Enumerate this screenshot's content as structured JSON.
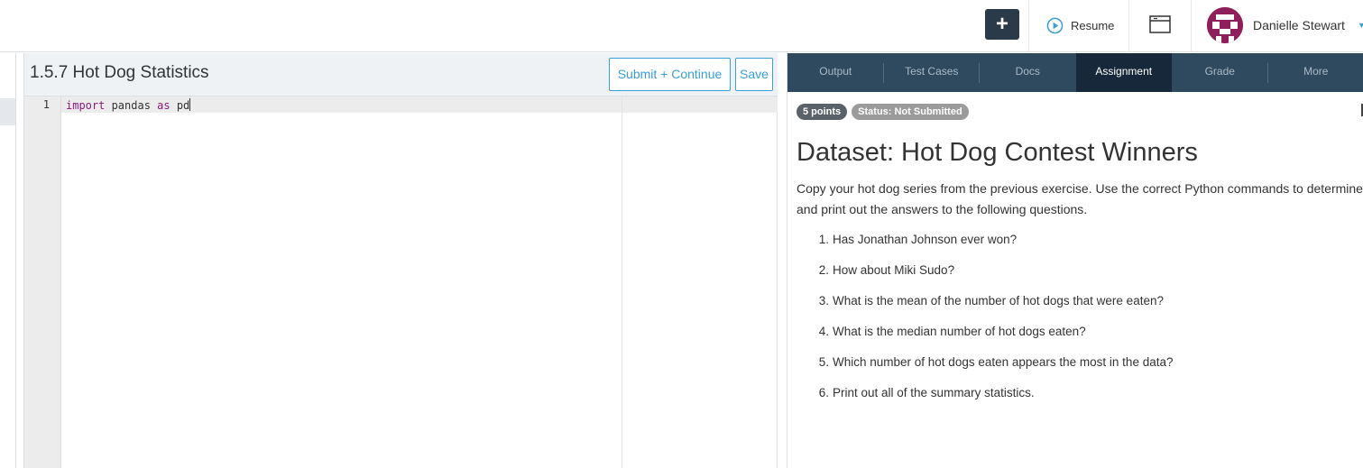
{
  "topbar": {
    "add_label": "+",
    "resume_label": "Resume",
    "user_name": "Danielle Stewart"
  },
  "editor": {
    "exercise_title": "1.5.7 Hot Dog Statistics",
    "submit_label": "Submit + Continue",
    "save_label": "Save",
    "line_number": "1",
    "code": {
      "kw1": "import",
      "plain1": " pandas ",
      "kw2": "as",
      "plain2": " pd"
    }
  },
  "tabs": [
    {
      "label": "Output"
    },
    {
      "label": "Test Cases"
    },
    {
      "label": "Docs"
    },
    {
      "label": "Assignment"
    },
    {
      "label": "Grade"
    },
    {
      "label": "More"
    }
  ],
  "active_tab": "Assignment",
  "assignment": {
    "points_badge": "5 points",
    "status_badge": "Status: Not Submitted",
    "title": "Dataset: Hot Dog Contest Winners",
    "description": "Copy your hot dog series from the previous exercise. Use the correct Python commands to determine and print out the answers to the following questions.",
    "questions": [
      {
        "num": "1.",
        "text": "Has Jonathan Johnson ever won?"
      },
      {
        "num": "2.",
        "text": "How about Miki Sudo?"
      },
      {
        "num": "3.",
        "text": "What is the mean of the number of hot dogs that were eaten?"
      },
      {
        "num": "4.",
        "text": "What is the median number of hot dogs eaten?"
      },
      {
        "num": "5.",
        "text": "Which number of hot dogs eaten appears the most in the data?"
      },
      {
        "num": "6.",
        "text": "Print out all of the summary statistics."
      }
    ]
  },
  "colors": {
    "tab_bar": "#2f4a5f",
    "tab_active": "#17283a",
    "accent": "#3a9fd6",
    "avatar": "#8f1f5a",
    "keyword": "#8b1a7a"
  }
}
